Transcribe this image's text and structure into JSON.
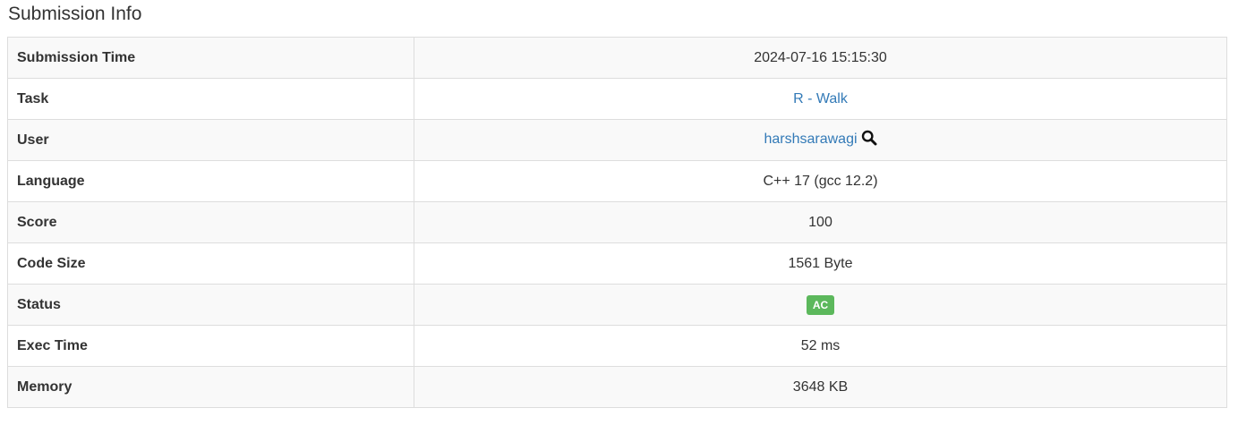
{
  "section_title": "Submission Info",
  "rows": {
    "submission_time": {
      "label": "Submission Time",
      "value": "2024-07-16 15:15:30"
    },
    "task": {
      "label": "Task",
      "value": "R - Walk"
    },
    "user": {
      "label": "User",
      "value": "harshsarawagi",
      "icon": "search-icon"
    },
    "language": {
      "label": "Language",
      "value": "C++ 17 (gcc 12.2)"
    },
    "score": {
      "label": "Score",
      "value": "100"
    },
    "code_size": {
      "label": "Code Size",
      "value": "1561 Byte"
    },
    "status": {
      "label": "Status",
      "value": "AC",
      "color": "#5cb85c"
    },
    "exec_time": {
      "label": "Exec Time",
      "value": "52 ms"
    },
    "memory": {
      "label": "Memory",
      "value": "3648 KB"
    }
  },
  "colors": {
    "link": "#337ab7",
    "accepted_badge": "#5cb85c",
    "row_stripe": "#f9f9f9",
    "border": "#dddddd"
  }
}
